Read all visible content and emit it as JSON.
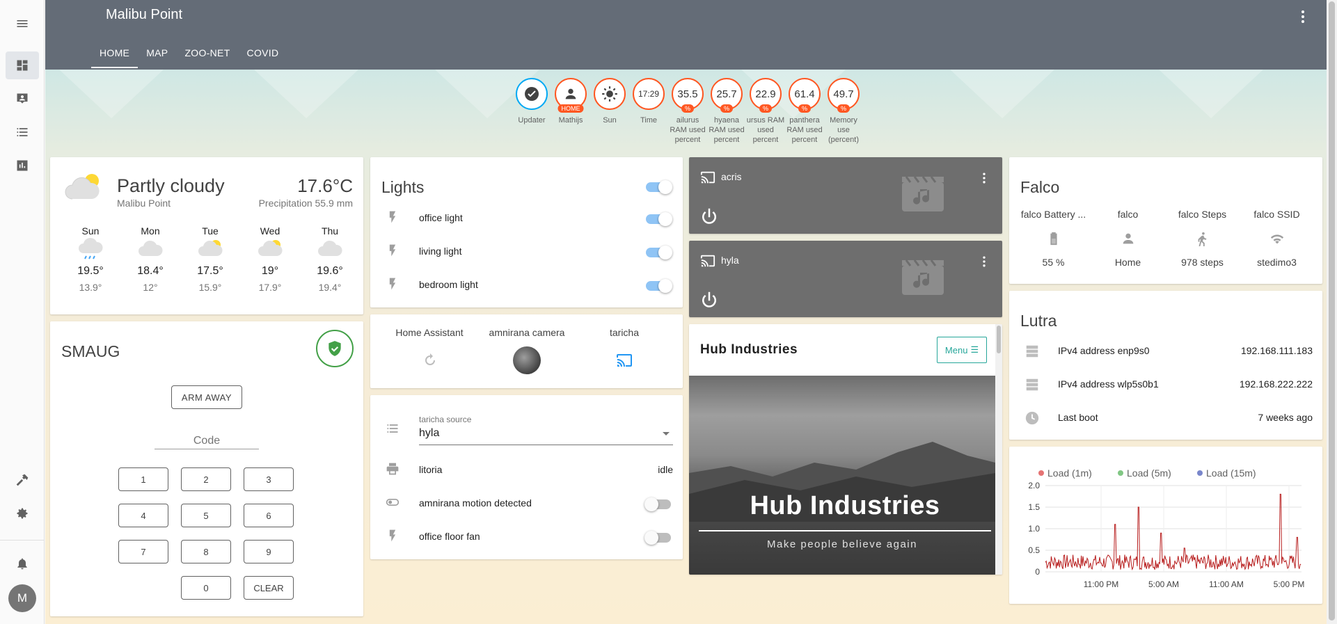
{
  "app": {
    "title": "Malibu Point",
    "tabs": [
      "HOME",
      "MAP",
      "ZOO-NET",
      "COVID"
    ],
    "active_tab": "HOME",
    "avatar": "M"
  },
  "sidebar": {
    "items": [
      "menu-icon",
      "dashboard-icon",
      "map-account-icon",
      "list-icon",
      "chart-icon",
      "hammer-icon",
      "gear-icon",
      "bell-icon"
    ]
  },
  "badges": [
    {
      "value": "",
      "label": "Updater",
      "icon": "check-circle-icon"
    },
    {
      "value": "",
      "unit": "HOME",
      "label": "Mathijs",
      "icon": "person-icon"
    },
    {
      "value": "",
      "label": "Sun",
      "icon": "sun-icon"
    },
    {
      "value": "17:29",
      "label": "Time"
    },
    {
      "value": "35.5",
      "unit": "%",
      "label": "ailurus RAM used percent"
    },
    {
      "value": "25.7",
      "unit": "%",
      "label": "hyaena RAM used percent"
    },
    {
      "value": "22.9",
      "unit": "%",
      "label": "ursus RAM used percent"
    },
    {
      "value": "61.4",
      "unit": "%",
      "label": "panthera RAM used percent"
    },
    {
      "value": "49.7",
      "unit": "%",
      "label": "Memory use (percent)"
    }
  ],
  "weather": {
    "condition": "Partly cloudy",
    "location": "Malibu Point",
    "temperature": "17.6°C",
    "precipitation": "Precipitation 55.9 mm",
    "forecast": [
      {
        "day": "Sun",
        "high": "19.5°",
        "low": "13.9°",
        "icon": "rainy-icon"
      },
      {
        "day": "Mon",
        "high": "18.4°",
        "low": "12°",
        "icon": "cloudy-icon"
      },
      {
        "day": "Tue",
        "high": "17.5°",
        "low": "15.9°",
        "icon": "partly-cloudy-icon"
      },
      {
        "day": "Wed",
        "high": "19°",
        "low": "17.9°",
        "icon": "partly-cloudy-icon"
      },
      {
        "day": "Thu",
        "high": "19.6°",
        "low": "19.4°",
        "icon": "cloudy-icon"
      }
    ]
  },
  "alarm": {
    "name": "SMAUG",
    "arm_away": "ARM AWAY",
    "code_placeholder": "Code",
    "keys": [
      "1",
      "2",
      "3",
      "4",
      "5",
      "6",
      "7",
      "8",
      "9",
      "0",
      "CLEAR"
    ]
  },
  "lights": {
    "title": "Lights",
    "master_on": true,
    "items": [
      {
        "name": "office light",
        "on": true
      },
      {
        "name": "living light",
        "on": true
      },
      {
        "name": "bedroom light",
        "on": true
      }
    ]
  },
  "glance": {
    "items": [
      {
        "name": "Home Assistant",
        "icon": "restart-icon"
      },
      {
        "name": "amnirana camera",
        "icon": "camera-avatar"
      },
      {
        "name": "taricha",
        "icon": "cast-icon"
      }
    ]
  },
  "entities": {
    "source_label": "taricha source",
    "source_value": "hyla",
    "printer": {
      "name": "litoria",
      "state": "idle"
    },
    "motion": {
      "name": "amnirana motion detected",
      "on": false
    },
    "fan": {
      "name": "office floor fan",
      "on": false
    }
  },
  "media": [
    {
      "name": "acris"
    },
    {
      "name": "hyla"
    }
  ],
  "hub": {
    "title": "Hub Industries",
    "menu": "Menu",
    "logo_text": "Hub Industries",
    "tagline": "Make people believe again"
  },
  "falco": {
    "title": "Falco",
    "items": [
      {
        "name": "falco Battery ...",
        "value": "55 %",
        "icon": "battery-icon"
      },
      {
        "name": "falco",
        "value": "Home",
        "icon": "person-icon"
      },
      {
        "name": "falco Steps",
        "value": "978 steps",
        "icon": "walk-icon"
      },
      {
        "name": "falco SSID",
        "value": "stedimo3",
        "icon": "wifi-icon"
      }
    ]
  },
  "lutra": {
    "title": "Lutra",
    "rows": [
      {
        "name": "IPv4 address enp9s0",
        "value": "192.168.111.183",
        "icon": "server-icon"
      },
      {
        "name": "IPv4 address wlp5s0b1",
        "value": "192.168.222.222",
        "icon": "server-icon"
      },
      {
        "name": "Last boot",
        "value": "7 weeks ago",
        "icon": "clock-icon"
      }
    ]
  },
  "chart_data": {
    "type": "line",
    "series": [
      {
        "name": "Load (1m)",
        "color": "#b71c1c"
      },
      {
        "name": "Load (5m)",
        "color": "#4caf50"
      },
      {
        "name": "Load (15m)",
        "color": "#5c6bc0"
      }
    ],
    "x_ticks": [
      "11:00 PM",
      "5:00 AM",
      "11:00 AM",
      "5:00 PM"
    ],
    "y_ticks": [
      "0",
      "0.5",
      "1.0",
      "1.5",
      "2.0"
    ],
    "ylim": [
      0,
      2.0
    ],
    "grid": true,
    "legend": "top"
  }
}
